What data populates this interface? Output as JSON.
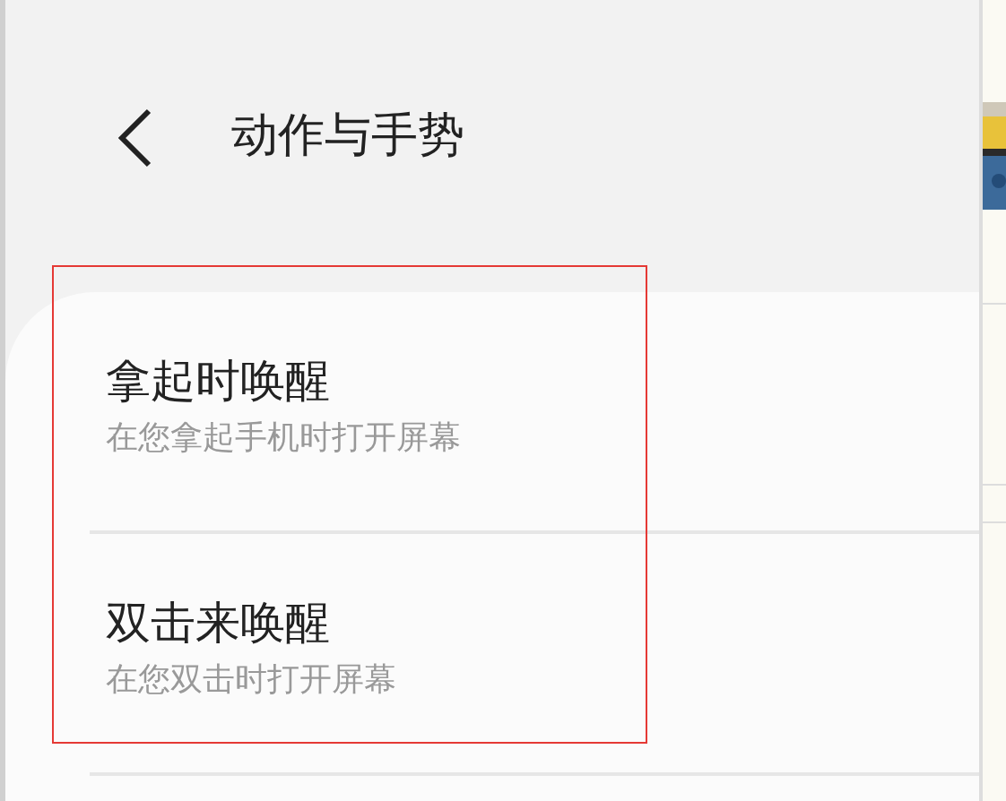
{
  "header": {
    "title": "动作与手势"
  },
  "settings": [
    {
      "title": "拿起时唤醒",
      "description": "在您拿起手机时打开屏幕"
    },
    {
      "title": "双击来唤醒",
      "description": "在您双击时打开屏幕"
    }
  ]
}
